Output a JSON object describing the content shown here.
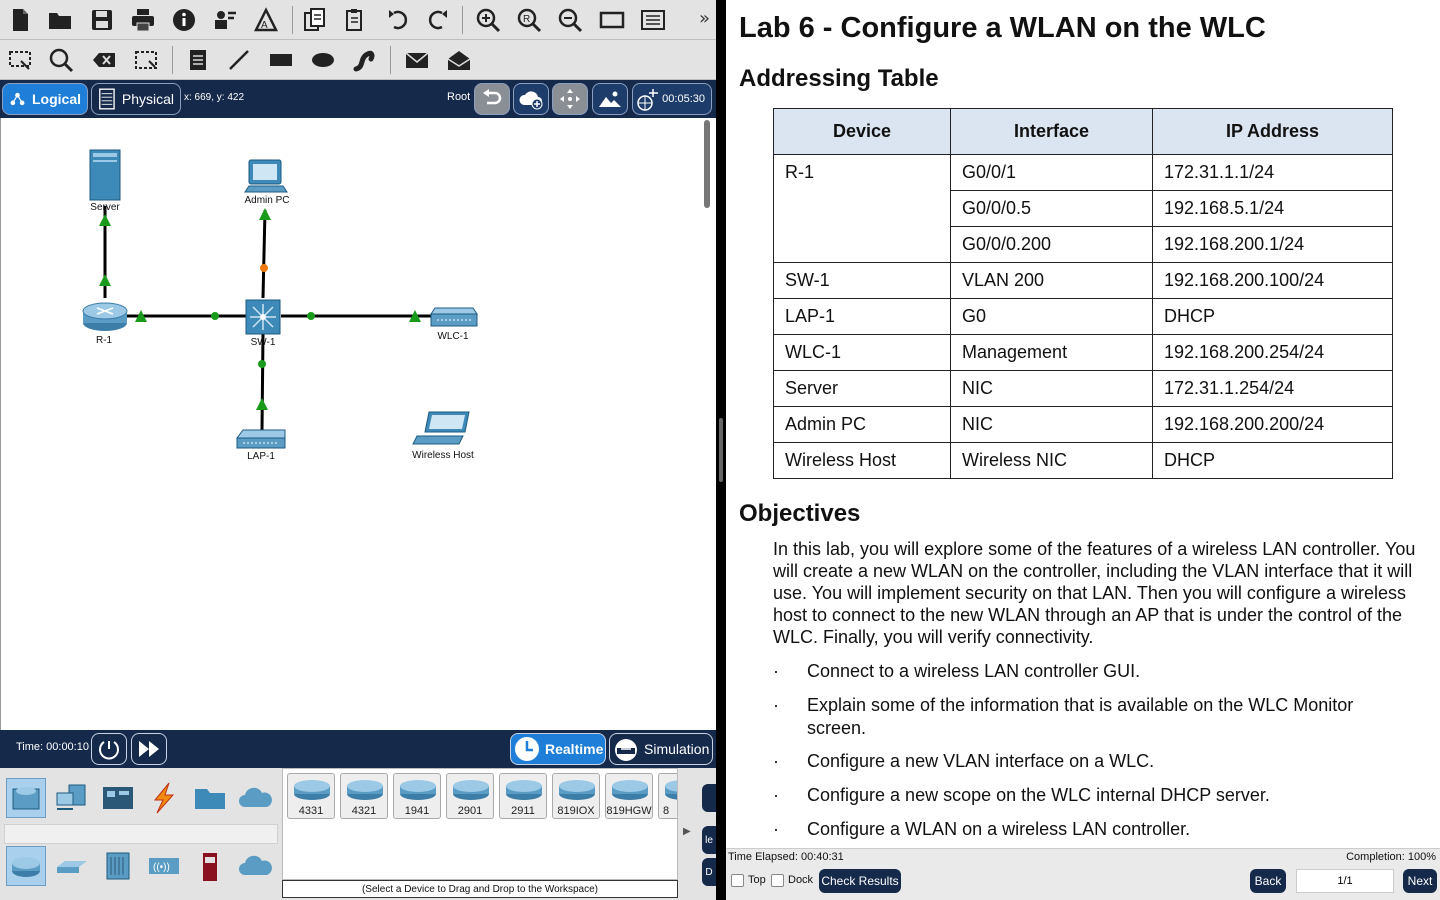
{
  "mode_bar": {
    "logical_label": "Logical",
    "physical_label": "Physical",
    "coords": "x: 669, y: 422",
    "root_label": "Root",
    "clock": "00:05:30"
  },
  "workspace": {
    "devices": [
      {
        "name": "Server"
      },
      {
        "name": "Admin PC"
      },
      {
        "name": "R-1"
      },
      {
        "name": "SW-1"
      },
      {
        "name": "WLC-1"
      },
      {
        "name": "LAP-1"
      },
      {
        "name": "Wireless Host"
      }
    ]
  },
  "time_bar": {
    "time_label": "Time: 00:00:10",
    "realtime_label": "Realtime",
    "simulation_label": "Simulation"
  },
  "device_panel": {
    "models": [
      "4331",
      "4321",
      "1941",
      "2901",
      "2911",
      "819IOX",
      "819HGW",
      "8"
    ],
    "hint": "(Select a Device to Drag and Drop to the Workspace)",
    "stub_top": "",
    "stub_mid": "le",
    "stub_bot": "D"
  },
  "doc": {
    "title": "Lab 6 - Configure a WLAN on the WLC",
    "addressing_heading": "Addressing Table",
    "table_headers": [
      "Device",
      "Interface",
      "IP Address"
    ],
    "table_rows": [
      {
        "device": "R-1",
        "interface": "G0/0/1",
        "ip": "172.31.1.1/24"
      },
      {
        "device": "",
        "interface": "G0/0/0.5",
        "ip": "192.168.5.1/24"
      },
      {
        "device": "",
        "interface": "G0/0/0.200",
        "ip": "192.168.200.1/24"
      },
      {
        "device": "SW-1",
        "interface": "VLAN 200",
        "ip": "192.168.200.100/24"
      },
      {
        "device": "LAP-1",
        "interface": "G0",
        "ip": "DHCP"
      },
      {
        "device": "WLC-1",
        "interface": "Management",
        "ip": "192.168.200.254/24"
      },
      {
        "device": "Server",
        "interface": "NIC",
        "ip": "172.31.1.254/24"
      },
      {
        "device": "Admin PC",
        "interface": "NIC",
        "ip": "192.168.200.200/24"
      },
      {
        "device": "Wireless Host",
        "interface": "Wireless NIC",
        "ip": "DHCP"
      }
    ],
    "objectives_heading": "Objectives",
    "objectives_paragraph": "In this lab, you will explore some of the features of a wireless LAN controller. You will create a new WLAN on the controller, including the VLAN interface that it will use. You will implement security on that LAN. Then you will configure a wireless host to connect to the new WLAN through an AP that is under the control of the WLC. Finally, you will verify connectivity.",
    "bullet_char": "·",
    "bullets": [
      "Connect to a wireless LAN controller GUI.",
      "Explain some of the information that is available on the WLC Monitor screen.",
      "Configure a new VLAN interface on a WLC.",
      "Configure a new scope on the WLC internal DHCP server.",
      "Configure a WLAN on a wireless LAN controller."
    ]
  },
  "doc_footer": {
    "elapsed": "Time Elapsed: 00:40:31",
    "completion": "Completion: 100%",
    "top_label": "Top",
    "dock_label": "Dock",
    "check_results": "Check Results",
    "back": "Back",
    "page": "1/1",
    "next": "Next"
  },
  "colors": {
    "dark_navy": "#15294a",
    "accent_blue": "#1e7ed8",
    "table_header_bg": "#dbe5f1",
    "link_green": "#1a9a1a",
    "link_orange": "#f07a10"
  }
}
